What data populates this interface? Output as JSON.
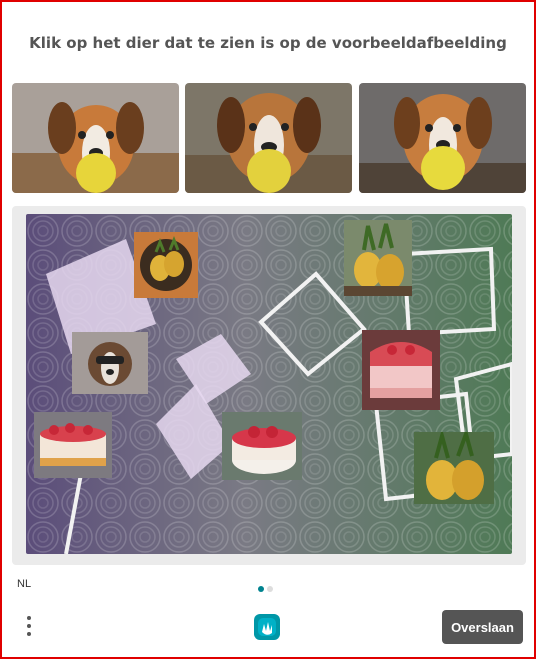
{
  "title": "Klik op het dier dat te zien is op de voorbeeldafbeelding",
  "examples": [
    {
      "icon": "dog-example-image-1"
    },
    {
      "icon": "dog-example-image-2"
    },
    {
      "icon": "dog-example-image-3"
    }
  ],
  "language": "NL",
  "pagination": {
    "active_index": 0,
    "count": 2
  },
  "skip_label": "Overslaan",
  "colors": {
    "frame": "#e00000",
    "button": "#555555",
    "dot_active": "#00838f",
    "dot_inactive": "#dddddd",
    "panel": "#ebebeb",
    "logo": "#0097a7"
  },
  "tiles": [
    {
      "name": "tile-pineapple-bowl",
      "icon": "pineapple-icon"
    },
    {
      "name": "tile-pineapple-top",
      "icon": "pineapple-icon"
    },
    {
      "name": "tile-dog",
      "icon": "dog-icon"
    },
    {
      "name": "tile-strawberry-cake-right",
      "icon": "cake-icon"
    },
    {
      "name": "tile-strawberry-cake-left",
      "icon": "cake-icon"
    },
    {
      "name": "tile-strawberry-cake-center",
      "icon": "cake-icon"
    },
    {
      "name": "tile-pineapple-bottom",
      "icon": "pineapple-icon"
    }
  ]
}
